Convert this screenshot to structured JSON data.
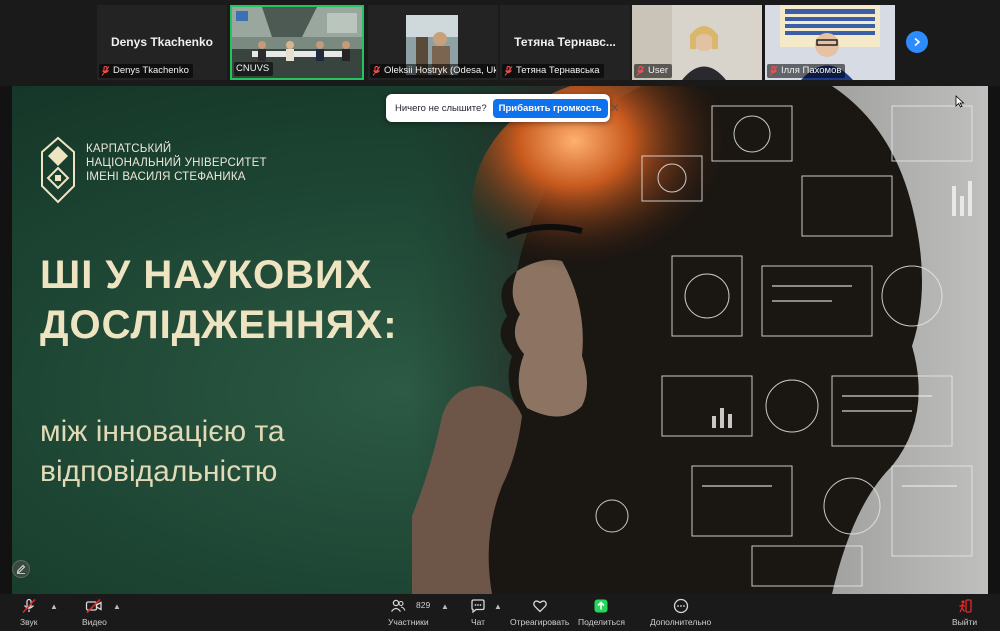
{
  "participants": [
    {
      "tile_name": "Denys Tkachenko",
      "label": "Denys Tkachenko",
      "muted": true
    },
    {
      "tile_name": "",
      "label": "CNUVS",
      "muted": false
    },
    {
      "tile_name": "",
      "label": "Oleksii Hostryk (Odesa, Ukrai...",
      "muted": true
    },
    {
      "tile_name": "Тетяна  Тернавс...",
      "label": "Тетяна Тернавська",
      "muted": true
    },
    {
      "tile_name": "",
      "label": "User",
      "muted": true
    },
    {
      "tile_name": "",
      "label": "Ілля Пахомов",
      "muted": true
    }
  ],
  "notification": {
    "text": "Ничего не слышите?",
    "button": "Прибавить громкость"
  },
  "slide": {
    "university": [
      "Карпатський",
      "національний університет",
      "імені Василя Стефаника"
    ],
    "title_lines": [
      "ШІ У НАУКОВИХ",
      "ДОСЛІДЖЕННЯХ:"
    ],
    "subtitle_lines": [
      "між інновацією та",
      "відповідальністю"
    ]
  },
  "toolbar": {
    "audio": "Звук",
    "video": "Видео",
    "participants": "Участники",
    "participants_count": "829",
    "chat": "Чат",
    "react": "Отреагировать",
    "share": "Поделиться",
    "more": "Дополнительно",
    "leave": "Выйти"
  },
  "colors": {
    "slide_green": "#1e4634",
    "title_cream": "#efe4c2",
    "accent_blue": "#0e72ed",
    "active_speaker": "#22c55e",
    "share_green": "#23d959",
    "leave_red": "#e02828"
  }
}
